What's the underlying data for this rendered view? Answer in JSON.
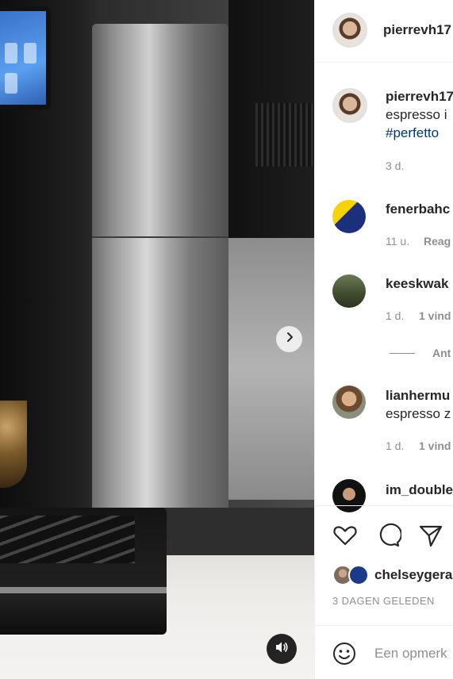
{
  "post": {
    "owner_username": "pierrevh17",
    "caption_username": "pierrevh17",
    "caption_text": "espresso i",
    "caption_hashtag": "#perfetto",
    "caption_time": "3 d."
  },
  "comments": [
    {
      "username": "fenerbahc",
      "text": "",
      "time": "11 u.",
      "extra": "Reag"
    },
    {
      "username": "keeskwak",
      "text": "",
      "time": "1 d.",
      "extra": "1 vind"
    },
    {
      "username": "lianhermu",
      "text": "espresso z",
      "time": "1 d.",
      "extra": "1 vind"
    },
    {
      "username": "im_double",
      "text": "",
      "time": "",
      "extra": ""
    }
  ],
  "replies_toggle": "Ant",
  "likes_by": "chelseygera",
  "post_date": "3 DAGEN GELEDEN",
  "comment_placeholder": "Een opmerk",
  "icons": {
    "next": "chevron-right-icon",
    "audio": "speaker-icon",
    "like": "heart-icon",
    "comment": "comment-bubble-icon",
    "share": "paper-plane-icon",
    "emoji": "smiley-icon"
  }
}
